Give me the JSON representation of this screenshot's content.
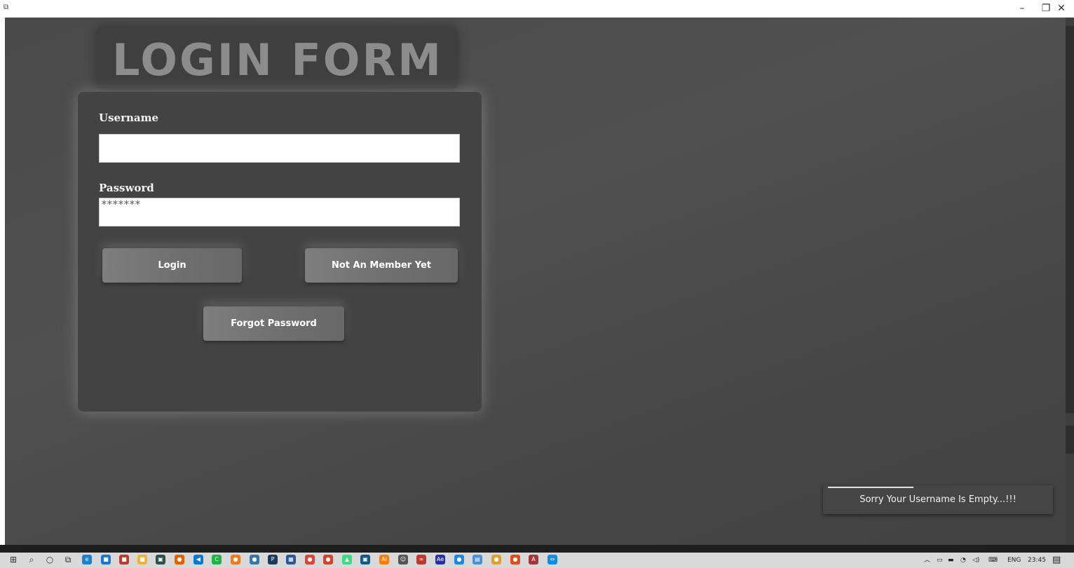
{
  "window": {
    "minimize_glyph": "–",
    "restore_glyph": "❐",
    "close_glyph": "✕"
  },
  "form": {
    "title": "LOGIN FORM",
    "username_label": "Username",
    "username_value": "",
    "password_label": "Password",
    "password_value": "*******",
    "login_button": "Login",
    "signup_button": "Not An Member Yet",
    "forgot_button": "Forgot Password"
  },
  "toast": {
    "message": "Sorry Your Username Is Empty...!!!",
    "progress": 0.39
  },
  "taskbar": {
    "icons": [
      {
        "name": "start-icon",
        "color": "#2b2b2b",
        "glyph": "⊞"
      },
      {
        "name": "search-icon",
        "color": "#2b2b2b",
        "glyph": "⌕"
      },
      {
        "name": "cortana-icon",
        "color": "#2b2b2b",
        "glyph": "○"
      },
      {
        "name": "task-view-icon",
        "color": "#2b2b2b",
        "glyph": "⧉"
      },
      {
        "name": "edge-icon",
        "color": "#1f7fd1",
        "glyph": "e"
      },
      {
        "name": "store-icon",
        "color": "#1976d2",
        "glyph": "■"
      },
      {
        "name": "active-app-icon",
        "color": "#c0392b",
        "glyph": "■"
      },
      {
        "name": "file-explorer-icon",
        "color": "#f2b233",
        "glyph": "■"
      },
      {
        "name": "terminal-icon",
        "color": "#2f4f4f",
        "glyph": "▣"
      },
      {
        "name": "firefox-icon",
        "color": "#e66000",
        "glyph": "●"
      },
      {
        "name": "vscode-icon",
        "color": "#0a7ad1",
        "glyph": "◀"
      },
      {
        "name": "clion-icon",
        "color": "#21b34a",
        "glyph": "C"
      },
      {
        "name": "brave-icon",
        "color": "#f27a1a",
        "glyph": "●"
      },
      {
        "name": "python-icon",
        "color": "#3776ab",
        "glyph": "●"
      },
      {
        "name": "pycharm-icon",
        "color": "#1e3c5a",
        "glyph": "P"
      },
      {
        "name": "sublime-icon",
        "color": "#2b5797",
        "glyph": "▦"
      },
      {
        "name": "chrome-icon",
        "color": "#db4437",
        "glyph": "●"
      },
      {
        "name": "media-player-icon",
        "color": "#d9412b",
        "glyph": "●"
      },
      {
        "name": "android-studio-icon",
        "color": "#3ddc84",
        "glyph": "▲"
      },
      {
        "name": "app-window-icon",
        "color": "#0e5a8a",
        "glyph": "▣"
      },
      {
        "name": "illustrator-icon",
        "color": "#ff7c00",
        "glyph": "Ai"
      },
      {
        "name": "github-icon",
        "color": "#555555",
        "glyph": "☺"
      },
      {
        "name": "link-app-icon",
        "color": "#c0392b",
        "glyph": "∞"
      },
      {
        "name": "after-effects-icon",
        "color": "#2a2fa6",
        "glyph": "Ae"
      },
      {
        "name": "circle-app-icon",
        "color": "#1e88e5",
        "glyph": "●"
      },
      {
        "name": "notepad-icon",
        "color": "#4a90d9",
        "glyph": "▤"
      },
      {
        "name": "ball-app-icon",
        "color": "#e0a030",
        "glyph": "●"
      },
      {
        "name": "color-app-icon",
        "color": "#e64a19",
        "glyph": "●"
      },
      {
        "name": "access-icon",
        "color": "#a4373a",
        "glyph": "A"
      },
      {
        "name": "teamviewer-icon",
        "color": "#0e8ee9",
        "glyph": "⇔"
      }
    ],
    "language": "ENG",
    "time": "23:45"
  }
}
